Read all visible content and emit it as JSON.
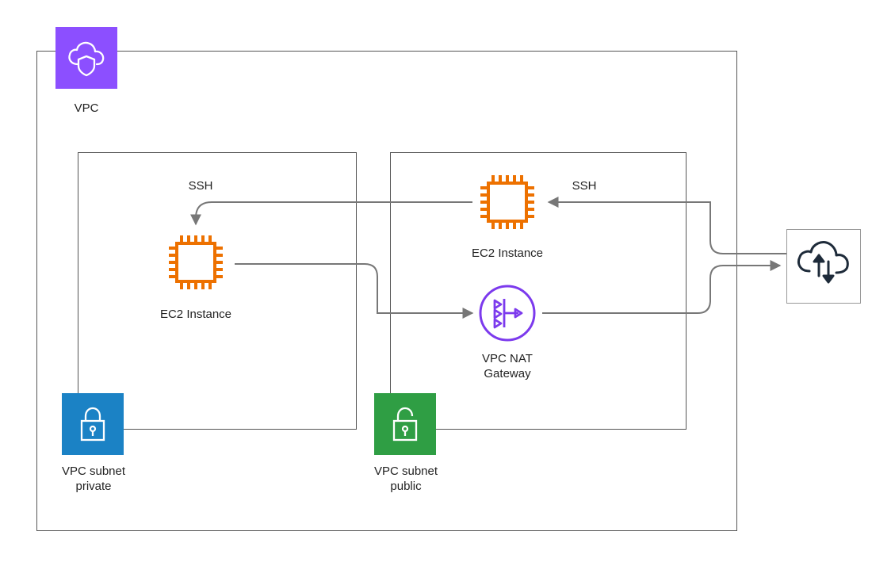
{
  "diagram": {
    "vpc_label": "VPC",
    "private_subnet_label": "VPC subnet\nprivate",
    "public_subnet_label": "VPC subnet\npublic",
    "ec2_private_label": "EC2 Instance",
    "ec2_public_label": "EC2 Instance",
    "nat_label": "VPC NAT\nGateway",
    "ssh_label_left": "SSH",
    "ssh_label_right": "SSH",
    "colors": {
      "vpc_badge": "#8C4FFF",
      "private_badge": "#1B82C5",
      "public_badge": "#2F9E44",
      "ec2": "#ED7100",
      "nat": "#7C3AED",
      "igw": "#1E2B3A",
      "line": "#777777"
    }
  }
}
